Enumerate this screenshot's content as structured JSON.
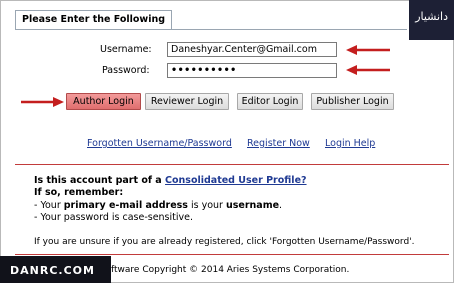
{
  "form": {
    "title": "Please Enter the Following",
    "username_label": "Username:",
    "username_value": "Daneshyar.Center@Gmail.com",
    "password_label": "Password:",
    "password_mask": "••••••••••"
  },
  "buttons": {
    "author": "Author Login",
    "reviewer": "Reviewer Login",
    "editor": "Editor Login",
    "publisher": "Publisher Login"
  },
  "links": {
    "forgot": "Forgotten Username/Password",
    "register": "Register Now",
    "help": "Login Help"
  },
  "info": {
    "q_prefix": "Is this account part of a ",
    "q_link": "Consolidated User Profile?",
    "remember": "If so, remember:",
    "line1_prefix": "- Your ",
    "line1_bold": "primary e-mail address",
    "line1_mid": " is your ",
    "line1_bold2": "username",
    "line1_suffix": ".",
    "line2": "- Your password is case-sensitive.",
    "unsure": "If you are unsure if you are already registered, click 'Forgotten Username/Password'."
  },
  "footer": {
    "text": "ftware Copyright © 2014 Aries Systems Corporation."
  },
  "watermark": {
    "logo_text": "دانشیار",
    "brand_text": "DANRC.COM"
  },
  "colors": {
    "arrow": "#c41e1e",
    "primary_button": "#e06e6e",
    "rule": "#c23b3b",
    "link": "#1f3a93"
  }
}
